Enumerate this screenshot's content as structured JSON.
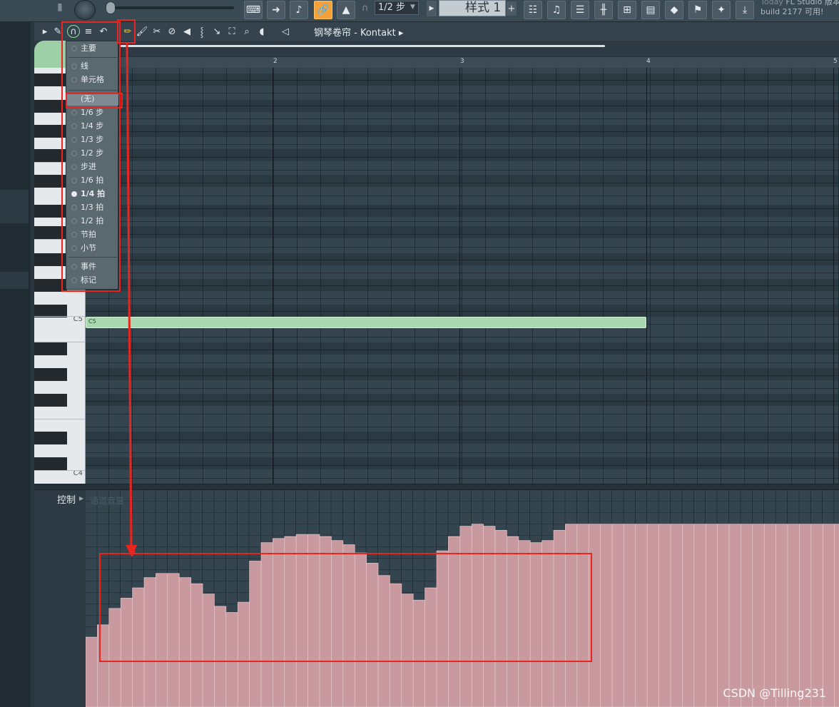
{
  "toolbar": {
    "snap_value": "1/2 步",
    "pattern_name": "样式 1",
    "news_line1": "FL Studio 版本",
    "news_line2": "build 2177 可用!",
    "news_today": "Today"
  },
  "piano_roll": {
    "title": "钢琴卷帘 - Kontakt",
    "bar_numbers": [
      "2",
      "3",
      "4",
      "5"
    ],
    "key_labels": [
      "C5",
      "C4"
    ],
    "note_label": "C5"
  },
  "snap_menu": {
    "items": [
      {
        "label": "主要",
        "selected": false
      },
      {
        "label": "线",
        "selected": false
      },
      {
        "label": "单元格",
        "selected": false
      },
      {
        "label": "(无)",
        "selected": false,
        "highlighted": true
      },
      {
        "label": "1/6 步",
        "selected": false
      },
      {
        "label": "1/4 步",
        "selected": false
      },
      {
        "label": "1/3 步",
        "selected": false
      },
      {
        "label": "1/2 步",
        "selected": false
      },
      {
        "label": "步进",
        "selected": false
      },
      {
        "label": "1/6 拍",
        "selected": false
      },
      {
        "label": "1/4 拍",
        "selected": true
      },
      {
        "label": "1/3 拍",
        "selected": false
      },
      {
        "label": "1/2 拍",
        "selected": false
      },
      {
        "label": "节拍",
        "selected": false
      },
      {
        "label": "小节",
        "selected": false
      },
      {
        "label": "事件",
        "selected": false
      },
      {
        "label": "标记",
        "selected": false
      }
    ]
  },
  "control_lane": {
    "label": "控制",
    "ghost_label": "通道音量",
    "levels": [
      0.34,
      0.4,
      0.48,
      0.53,
      0.58,
      0.63,
      0.65,
      0.65,
      0.63,
      0.6,
      0.55,
      0.49,
      0.46,
      0.51,
      0.71,
      0.8,
      0.82,
      0.83,
      0.84,
      0.84,
      0.83,
      0.81,
      0.79,
      0.75,
      0.7,
      0.64,
      0.6,
      0.55,
      0.52,
      0.58,
      0.76,
      0.83,
      0.88,
      0.89,
      0.88,
      0.86,
      0.83,
      0.81,
      0.8,
      0.81,
      0.86,
      0.89,
      0.89,
      0.89,
      0.89,
      0.89,
      0.89,
      0.89,
      0.89,
      0.89,
      0.89,
      0.89,
      0.89,
      0.89,
      0.89,
      0.89,
      0.89,
      0.89,
      0.89,
      0.89,
      0.89,
      0.89,
      0.89,
      0.89,
      0.89
    ]
  },
  "colors": {
    "automation_fill": "#c89aa0",
    "annotation_red": "#e8261f",
    "note_green": "#a9d8b1"
  },
  "watermark": "CSDN @Tilling231"
}
